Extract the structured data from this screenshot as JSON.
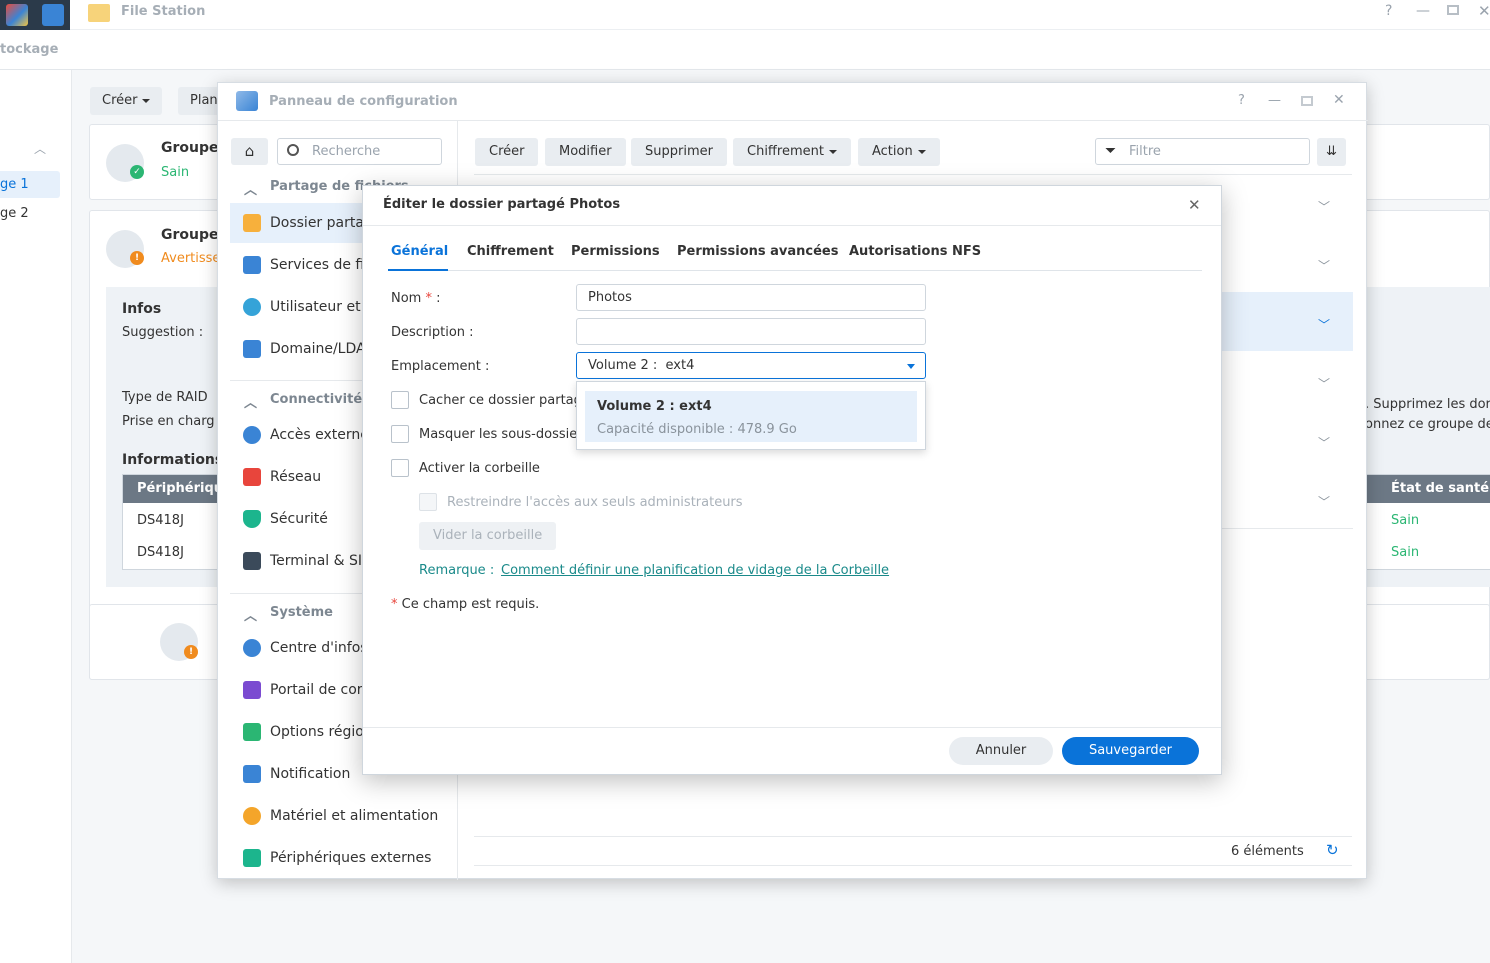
{
  "background": {
    "app_title": "File Station",
    "section_label": "tockage",
    "create_label": "Créer",
    "plan_label": "Plan",
    "left_items": [
      "ge 1",
      "ge 2"
    ],
    "group1": {
      "title": "Groupe",
      "status": "Sain"
    },
    "group2": {
      "title": "Groupe",
      "status": "Avertisse"
    },
    "infos_title": "Infos",
    "suggestion_label": "Suggestion :",
    "raid_type_label": "Type de RAID",
    "support_label": "Prise en charg",
    "informations_label": "Informations",
    "peripheral_header": "Périphérique",
    "devices": [
      "DS418J",
      "DS418J"
    ],
    "health_header": "État de santé",
    "health_values": [
      "Sain",
      "Sain"
    ],
    "side_text_1": ". Supprimez les dor",
    "side_text_2": "onnez ce groupe de"
  },
  "control_panel": {
    "title": "Panneau de configuration",
    "search_placeholder": "Recherche",
    "sections": {
      "file_sharing": "Partage de fichiers",
      "connectivity": "Connectivité",
      "system": "Système"
    },
    "items": {
      "shared_folder": "Dossier parta",
      "file_services": "Services de fi",
      "user": "Utilisateur et",
      "domain": "Domaine/LDA",
      "external_access": "Accès externe",
      "network": "Réseau",
      "security": "Sécurité",
      "terminal": "Terminal & SI",
      "info_center": "Centre d'infos",
      "portal": "Portail de cor",
      "regional": "Options régio",
      "notification": "Notification",
      "hardware": "Matériel et alimentation",
      "external_devices": "Périphériques externes"
    },
    "toolbar": {
      "create": "Créer",
      "modify": "Modifier",
      "delete": "Supprimer",
      "encryption": "Chiffrement",
      "action": "Action",
      "filter_placeholder": "Filtre"
    },
    "footer_count": "6 éléments"
  },
  "modal": {
    "title": "Éditer le dossier partagé Photos",
    "tabs": [
      "Général",
      "Chiffrement",
      "Permissions",
      "Permissions avancées",
      "Autorisations NFS"
    ],
    "name_label": "Nom",
    "required_mark": "*",
    "colon": ":",
    "name_value": "Photos",
    "description_label": "Description :",
    "description_value": "",
    "location_label": "Emplacement :",
    "location_value": "Volume 2 :  ext4",
    "dropdown_option_title": "Volume 2 : ext4",
    "dropdown_option_sub": "Capacité disponible : 478.9 Go",
    "hide_folder_label": "Cacher ce dossier partag",
    "hide_subfolders_label": "Masquer les sous-dossie",
    "recycle_bin_label": "Activer la corbeille",
    "restrict_admin_label": "Restreindre l'accès aux seuls administrateurs",
    "empty_bin_label": "Vider la corbeille",
    "remark_label": "Remarque :",
    "remark_link": "Comment définir une planification de vidage de la Corbeille",
    "required_note": "Ce champ est requis.",
    "cancel_label": "Annuler",
    "save_label": "Sauvegarder"
  },
  "colors": {
    "accent": "#0a73d9",
    "ok": "#2bb673",
    "warning": "#f08b1e",
    "required": "#e8453c"
  }
}
